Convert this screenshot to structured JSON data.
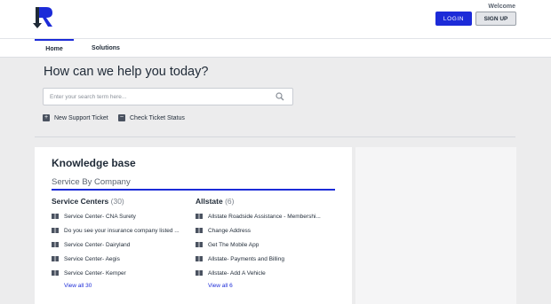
{
  "header": {
    "welcome": "Welcome",
    "login_label": "LOGIN",
    "signup_label": "SIGN UP"
  },
  "nav": {
    "tabs": [
      {
        "label": "Home",
        "active": true
      },
      {
        "label": "Solutions",
        "active": false
      }
    ]
  },
  "hero": {
    "title": "How can we help you today?",
    "search_placeholder": "Enter your search term here..."
  },
  "actions": {
    "new_ticket": "New Support Ticket",
    "check_status": "Check Ticket Status"
  },
  "knowledge_base": {
    "title": "Knowledge base",
    "category": "Service By Company",
    "columns": [
      {
        "name": "Service Centers",
        "count": "(30)",
        "items": [
          "Service Center- CNA Surety",
          "Do you see your insurance company listed ...",
          "Service Center- Dairyland",
          "Service Center- Aegis",
          "Service Center- Kemper"
        ],
        "view_all": "View all 30"
      },
      {
        "name": "Allstate",
        "count": "(6)",
        "items": [
          "Allstate Roadside Assistance - Membershi...",
          "Change Address",
          "Get The Mobile App",
          "Allstate- Payments and Billing",
          "Allstate- Add A Vehicle"
        ],
        "view_all": "View all 6"
      }
    ]
  },
  "colors": {
    "accent": "#1c2bd8",
    "text": "#1f2a37",
    "background": "#ececed"
  }
}
